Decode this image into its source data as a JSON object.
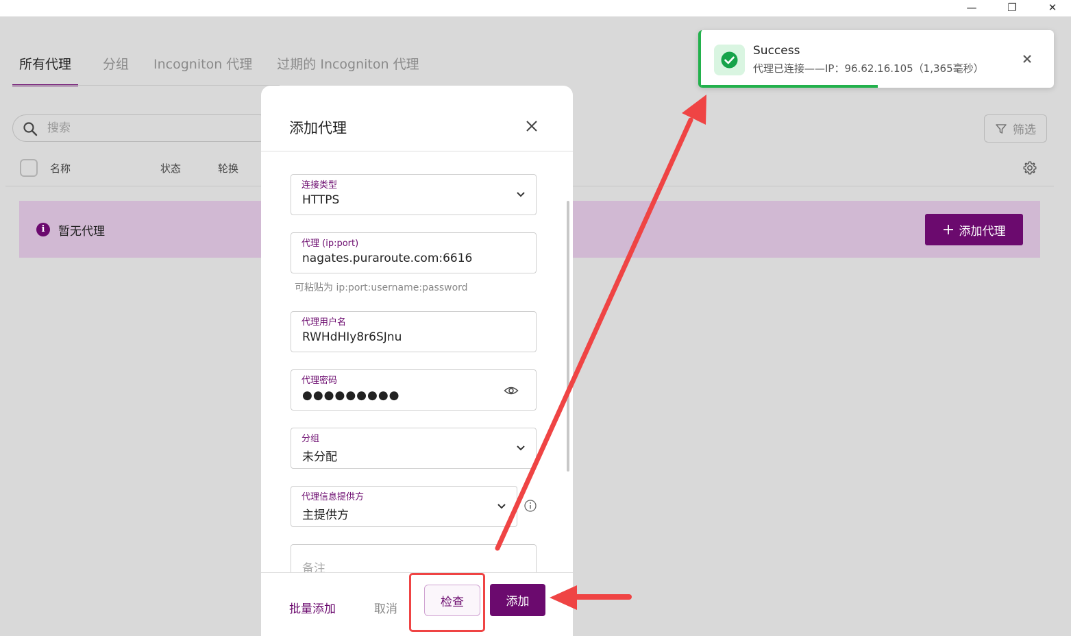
{
  "window": {
    "minimize": "—",
    "restore": "❐",
    "close": "✕"
  },
  "tabs": [
    {
      "label": "所有代理",
      "active": true
    },
    {
      "label": "分组",
      "active": false
    },
    {
      "label": "Incogniton 代理",
      "active": false
    },
    {
      "label": "过期的 Incogniton 代理",
      "active": false
    }
  ],
  "search": {
    "placeholder": "搜索",
    "value": ""
  },
  "filter": {
    "label": "筛选"
  },
  "table": {
    "columns": [
      "名称",
      "状态",
      "轮换"
    ]
  },
  "empty_banner": {
    "text": "暂无代理",
    "add_button": "添加代理"
  },
  "modal": {
    "title": "添加代理",
    "fields": {
      "connection_type": {
        "label": "连接类型",
        "value": "HTTPS"
      },
      "proxy": {
        "label": "代理 (ip:port)",
        "value": "nagates.puraroute.com:6616",
        "hint": "可粘贴为 ip:port:username:password"
      },
      "username": {
        "label": "代理用户名",
        "value": "RWHdHIy8r6SJnu"
      },
      "password": {
        "label": "代理密码",
        "value": "●●●●●●●●●"
      },
      "group": {
        "label": "分组",
        "value": "未分配"
      },
      "provider": {
        "label": "代理信息提供方",
        "value": "主提供方"
      },
      "notes": {
        "placeholder": "备注"
      }
    },
    "footer": {
      "bulk_add": "批量添加",
      "cancel": "取消",
      "check": "检查",
      "add": "添加"
    }
  },
  "toast": {
    "title": "Success",
    "message": "代理已连接——IP：96.62.16.105（1,365毫秒）",
    "progress": 0.5
  },
  "colors": {
    "brand": "#6b0a6e",
    "success": "#22b14c",
    "annotation": "#ef4444"
  }
}
